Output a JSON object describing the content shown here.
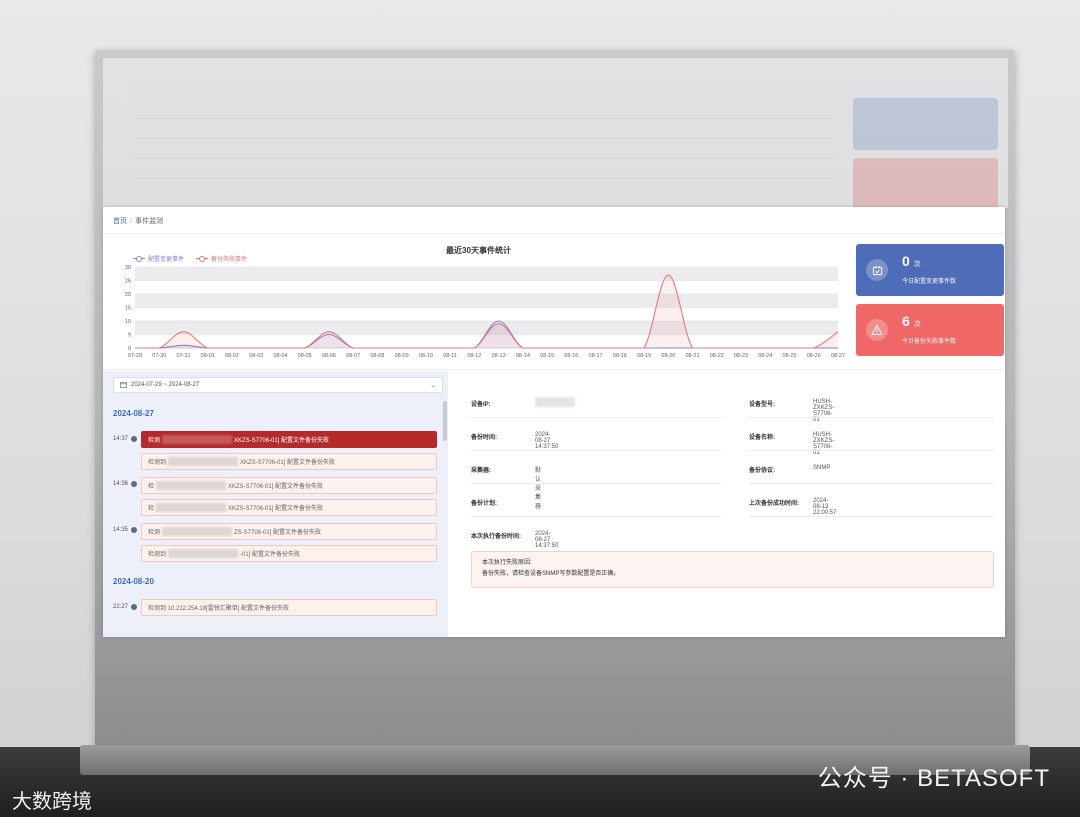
{
  "breadcrumb": {
    "home": "首页",
    "current": "事件监测"
  },
  "chart_data": {
    "type": "line",
    "title": "最近30天事件统计",
    "categories": [
      "07-29",
      "07-30",
      "07-31",
      "08-01",
      "08-02",
      "08-03",
      "08-04",
      "08-05",
      "08-06",
      "08-07",
      "08-08",
      "08-09",
      "08-10",
      "08-11",
      "08-12",
      "08-13",
      "08-14",
      "08-15",
      "08-16",
      "08-17",
      "08-18",
      "08-19",
      "08-20",
      "08-21",
      "08-22",
      "08-23",
      "08-24",
      "08-25",
      "08-26",
      "08-27"
    ],
    "series": [
      {
        "name": "配置变更事件",
        "color": "#7c86d6",
        "values": [
          0,
          0,
          1,
          0,
          0,
          0,
          0,
          0,
          5,
          0,
          0,
          0,
          0,
          0,
          0,
          10,
          0,
          0,
          0,
          0,
          0,
          0,
          0,
          0,
          0,
          0,
          0,
          0,
          0,
          0
        ]
      },
      {
        "name": "备份失败事件",
        "color": "#e57a7a",
        "values": [
          0,
          0,
          6,
          0,
          0,
          0,
          0,
          0,
          6,
          0,
          0,
          0,
          0,
          0,
          0,
          9,
          0,
          0,
          0,
          0,
          0,
          0,
          27,
          0,
          0,
          0,
          0,
          0,
          0,
          6
        ]
      }
    ],
    "ylim": [
      0,
      30
    ],
    "yticks": [
      0,
      5,
      10,
      15,
      20,
      25,
      30
    ],
    "grid": true,
    "legend": "top-left"
  },
  "cards": {
    "config": {
      "count": "0",
      "unit": "次",
      "desc": "今日配置变更事件数",
      "icon": "calendar-check-icon",
      "color": "#4f6cb8"
    },
    "backup": {
      "count": "6",
      "unit": "次",
      "desc": "今日备份失败事件数",
      "icon": "warning-triangle-icon",
      "color": "#ef6767"
    }
  },
  "timeline": {
    "date_range": "2024-07-29 ~ 2024-08-27",
    "days": [
      {
        "date": "2024-08-27",
        "groups": [
          {
            "time": "14:37",
            "events": [
              {
                "pre": "检测",
                "post": "XKZS-S7706-01] 配置文件备份失败",
                "active": true
              },
              {
                "pre": "检测到",
                "post": "XKZS-S7706-01] 配置文件备份失败",
                "active": false
              }
            ]
          },
          {
            "time": "14:36",
            "events": [
              {
                "pre": "检",
                "post": "XKZS-S7706-01] 配置文件备份失败",
                "active": false
              },
              {
                "pre": "检",
                "post": "XKZS-S7706-01] 配置文件备份失败",
                "active": false
              }
            ]
          },
          {
            "time": "14:35",
            "events": [
              {
                "pre": "检测",
                "post": "ZS-S7706-01] 配置文件备份失败",
                "active": false
              },
              {
                "pre": "检测到",
                "post": "-01] 配置文件备份失败",
                "active": false
              }
            ]
          }
        ]
      },
      {
        "date": "2024-08-20",
        "groups": [
          {
            "time": "22:27",
            "events": [
              {
                "pre": "检测到 10.212.254.18[雷锐汇聚单] 配置文件备份失败",
                "post": "",
                "active": false
              }
            ]
          }
        ]
      }
    ]
  },
  "detail": {
    "ip_label": "设备IP:",
    "model_label": "设备型号:",
    "model_value": "HUSH-ZXKZS-S7706-01",
    "time_label": "备份时间:",
    "time_value": "2024-08-27 14:37:50",
    "name_label": "设备名称:",
    "name_value": "HUSH-ZXKZS-S7706-01",
    "collector_label": "采集器:",
    "collector_value": "默认采集器",
    "protocol_label": "备份协议:",
    "protocol_value": "SNMP",
    "plan_label": "备份计划:",
    "plan_value": "",
    "last_label": "上次备份成功时间:",
    "last_value": "2024-08-13 22:00:57",
    "exec_label": "本次执行备份时间:",
    "exec_value": "2024-08-27 14:37:50",
    "fail_title": "本次执行失败原因:",
    "fail_text": "备份失败，请检查设备SNMP写参数配置是否正确。"
  },
  "watermark": {
    "left": "大数跨境",
    "right": "公众号 · BETASOFT"
  }
}
